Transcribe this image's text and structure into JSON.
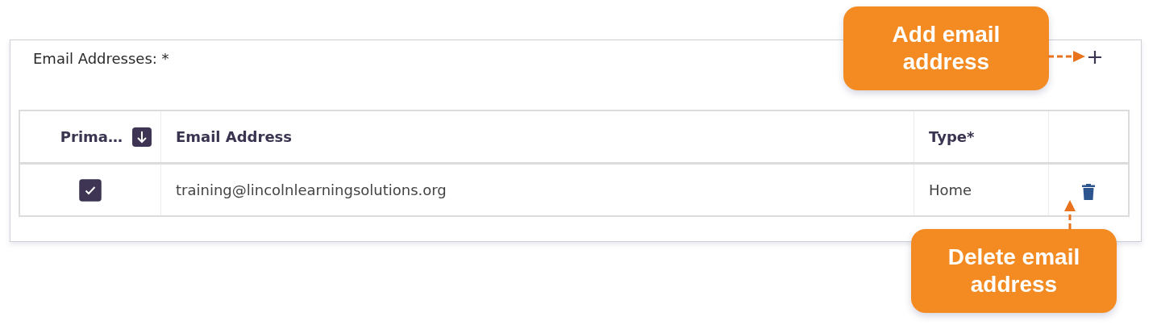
{
  "panel": {
    "label": "Email Addresses: *"
  },
  "table": {
    "columns": [
      {
        "label": "Prima…",
        "sorted": true
      },
      {
        "label": "Email Address",
        "sorted": false
      },
      {
        "label": "Type*",
        "sorted": false
      }
    ],
    "rows": [
      {
        "primary": true,
        "email": "training@lincolnlearningsolutions.org",
        "type": "Home"
      }
    ]
  },
  "callouts": [
    {
      "kind": "add",
      "text": "Add email address"
    },
    {
      "kind": "delete",
      "text": "Delete email address"
    }
  ]
}
